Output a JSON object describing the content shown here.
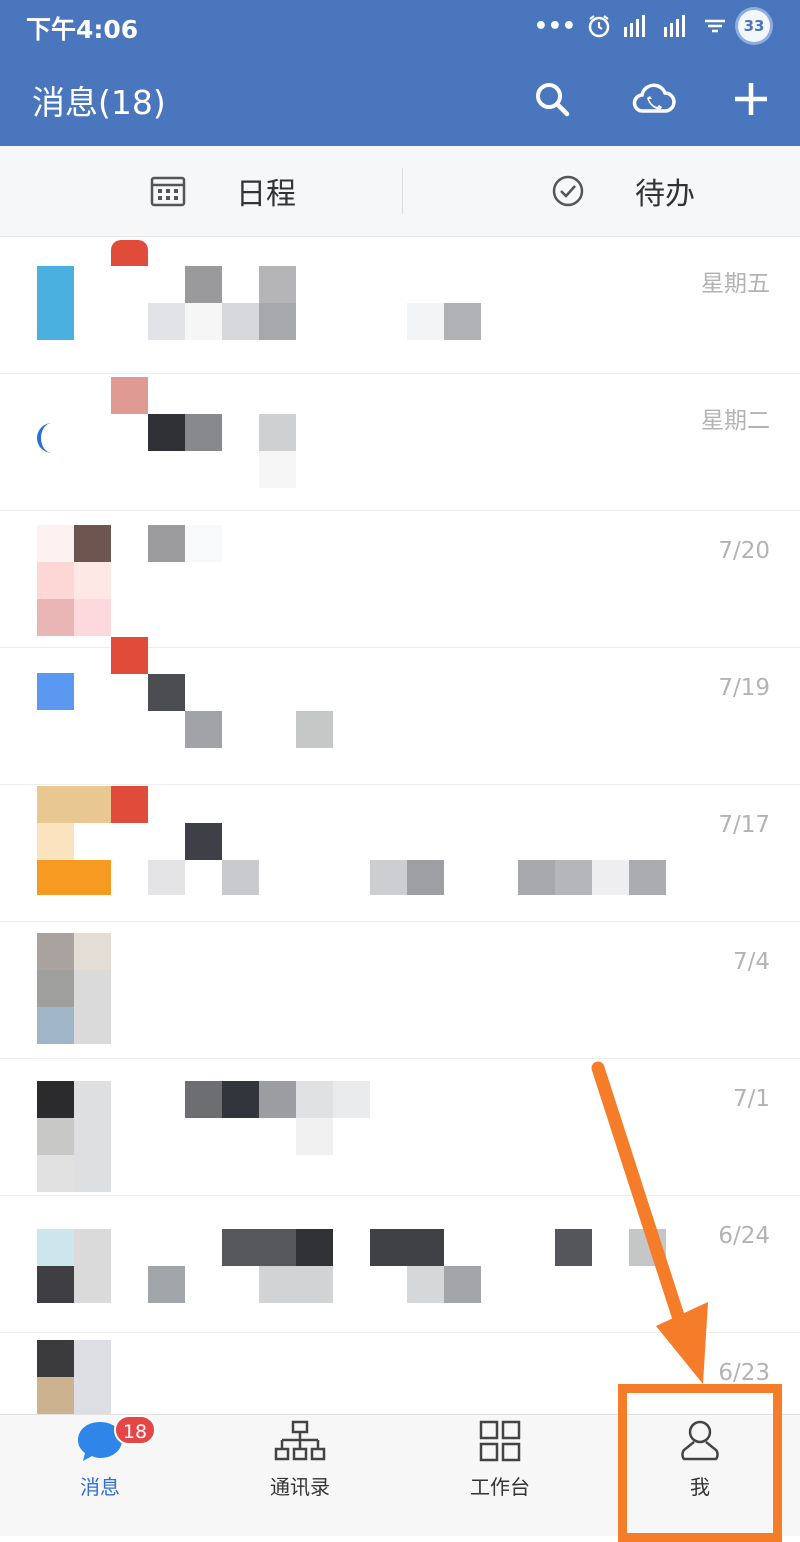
{
  "status_bar": {
    "time": "下午4:06",
    "dots": "•••",
    "battery": "33"
  },
  "header": {
    "title": "消息(18)",
    "icons": [
      "search-icon",
      "cloud-phone-icon",
      "plus-icon"
    ]
  },
  "quickbar": {
    "schedule": "日程",
    "todo": "待办"
  },
  "messages": [
    {
      "date": "星期五"
    },
    {
      "date": "星期二"
    },
    {
      "date": "7/20"
    },
    {
      "date": "7/19"
    },
    {
      "date": "7/17"
    },
    {
      "date": "7/4"
    },
    {
      "date": "7/1"
    },
    {
      "date": "6/24"
    },
    {
      "date": "6/23"
    }
  ],
  "tabbar": {
    "messages": {
      "label": "消息",
      "badge": "18",
      "active": true
    },
    "contacts": {
      "label": "通讯录"
    },
    "workbench": {
      "label": "工作台"
    },
    "me": {
      "label": "我"
    }
  },
  "colors": {
    "brand": "#4a76bd",
    "badge": "#e64545",
    "annotation": "#f57c28"
  }
}
